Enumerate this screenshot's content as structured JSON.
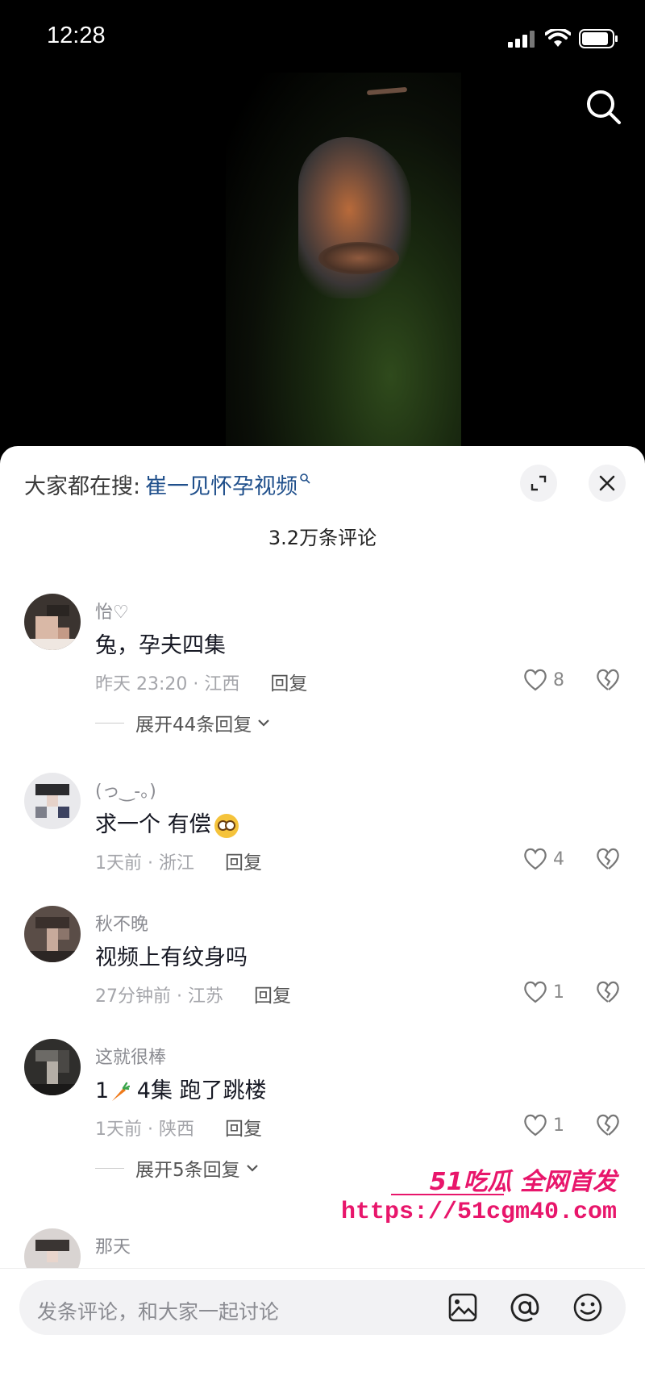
{
  "status_bar": {
    "time": "12:28"
  },
  "sheet": {
    "suggest_label": "大家都在搜:",
    "suggest_link": "崔一见怀孕视频",
    "comment_count": "3.2万条评论"
  },
  "comments": [
    {
      "name": "怡♡",
      "text": "兔，孕夫四集",
      "meta": "昨天 23:20 · 江西",
      "reply": "回复",
      "likes": "8",
      "expand": "展开44条回复"
    },
    {
      "name": "(っ‿-。)",
      "text": "求一个 有偿",
      "meta": "1天前 · 浙江",
      "reply": "回复",
      "likes": "4"
    },
    {
      "name": "秋不晚",
      "text": "视频上有纹身吗",
      "meta": "27分钟前 · 江苏",
      "reply": "回复",
      "likes": "1"
    },
    {
      "name": "这就很棒",
      "text_pre": "1",
      "text_post": " 4集 跑了跳楼",
      "meta": "1天前 · 陕西",
      "reply": "回复",
      "likes": "1",
      "expand": "展开5条回复"
    },
    {
      "name": "那天"
    }
  ],
  "watermark": {
    "line1": "51吃瓜 全网首发",
    "line2": "https://51cgm40.com"
  },
  "input": {
    "placeholder": "发条评论，和大家一起讨论"
  },
  "icons": [
    "search-icon",
    "expand-icon",
    "close-icon",
    "heart-icon",
    "dislike-icon",
    "chevron-down-icon",
    "image-icon",
    "at-icon",
    "emoji-icon"
  ]
}
